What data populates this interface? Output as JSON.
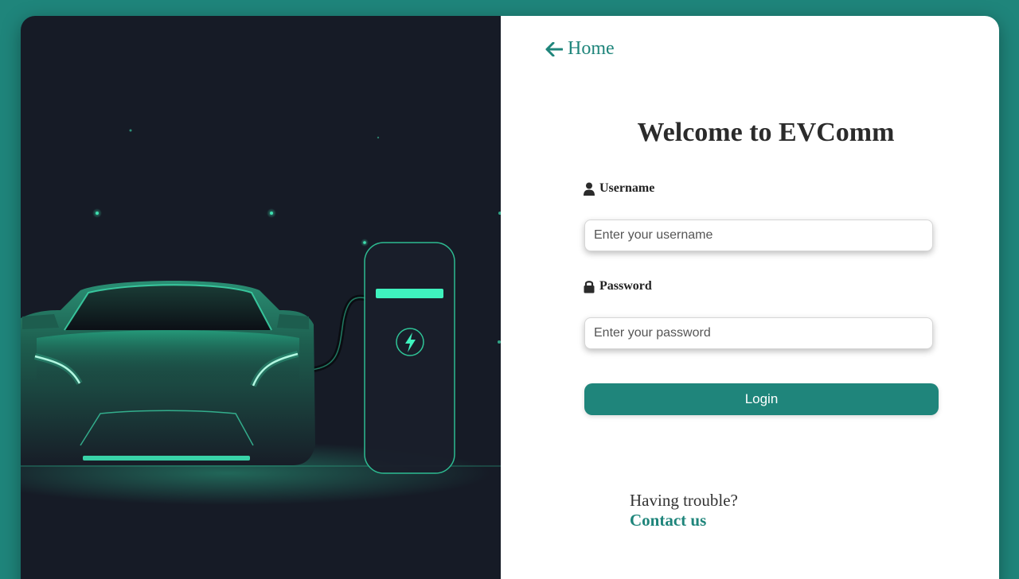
{
  "nav": {
    "home_label": "Home",
    "home_icon": "arrow-left-icon"
  },
  "login": {
    "title": "Welcome to EVComm",
    "username": {
      "label": "Username",
      "icon": "user-icon",
      "placeholder": "Enter your username",
      "value": ""
    },
    "password": {
      "label": "Password",
      "icon": "lock-icon",
      "placeholder": "Enter your password",
      "value": ""
    },
    "submit_label": "Login"
  },
  "help": {
    "prompt": "Having trouble?",
    "link_label": "Contact us"
  },
  "colors": {
    "accent": "#1f857b",
    "dark_panel": "#161b26",
    "glow": "#3fe0b0"
  }
}
